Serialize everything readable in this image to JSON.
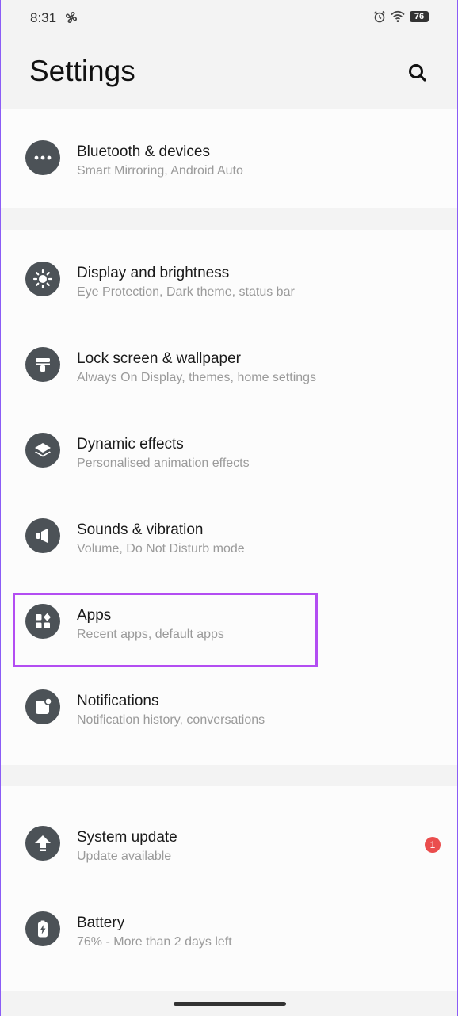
{
  "status_bar": {
    "time": "8:31",
    "battery": "76"
  },
  "header": {
    "title": "Settings"
  },
  "colors": {
    "accent_highlight": "#b34df2",
    "badge": "#ea4d4d",
    "icon_bg": "#4c5257"
  },
  "items": [
    {
      "id": "bluetooth",
      "title": "Bluetooth & devices",
      "subtitle": "Smart Mirroring, Android Auto",
      "icon": "more-dots-icon"
    },
    {
      "id": "display",
      "title": "Display and brightness",
      "subtitle": "Eye Protection, Dark theme, status bar",
      "icon": "brightness-icon"
    },
    {
      "id": "lockscreen",
      "title": "Lock screen & wallpaper",
      "subtitle": "Always On Display, themes, home settings",
      "icon": "wallpaper-icon"
    },
    {
      "id": "dynamic",
      "title": "Dynamic effects",
      "subtitle": "Personalised animation effects",
      "icon": "layers-icon"
    },
    {
      "id": "sounds",
      "title": "Sounds & vibration",
      "subtitle": "Volume, Do Not Disturb mode",
      "icon": "speaker-icon"
    },
    {
      "id": "apps",
      "title": "Apps",
      "subtitle": "Recent apps, default apps",
      "icon": "apps-grid-icon"
    },
    {
      "id": "notifications",
      "title": "Notifications",
      "subtitle": "Notification history, conversations",
      "icon": "notification-icon"
    },
    {
      "id": "system_update",
      "title": "System update",
      "subtitle": "Update available",
      "icon": "update-arrow-icon",
      "badge": "1"
    },
    {
      "id": "battery",
      "title": "Battery",
      "subtitle": "76% - More than 2 days left",
      "icon": "battery-icon"
    }
  ]
}
